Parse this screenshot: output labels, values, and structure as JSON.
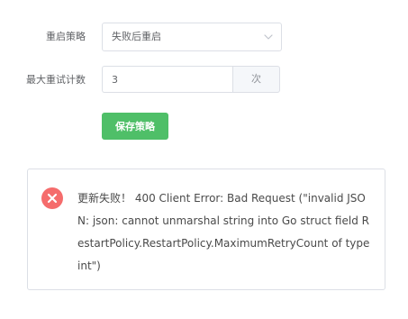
{
  "form": {
    "restart_policy": {
      "label": "重启策略",
      "selected": "失败后重启",
      "chevron_icon": "chevron-down-icon"
    },
    "max_retry": {
      "label": "最大重试计数",
      "value": "3",
      "suffix": "次"
    },
    "save_label": "保存策略"
  },
  "alert": {
    "icon": "error-circle-icon",
    "message": "更新失败！ 400 Client Error: Bad Request (\"invalid JSON: json: cannot unmarshal string into Go struct field RestartPolicy.RestartPolicy.MaximumRetryCount of type int\")"
  },
  "colors": {
    "primary_green": "#4fbf68",
    "error_red": "#f56c6c",
    "border": "#dcdfe6"
  }
}
